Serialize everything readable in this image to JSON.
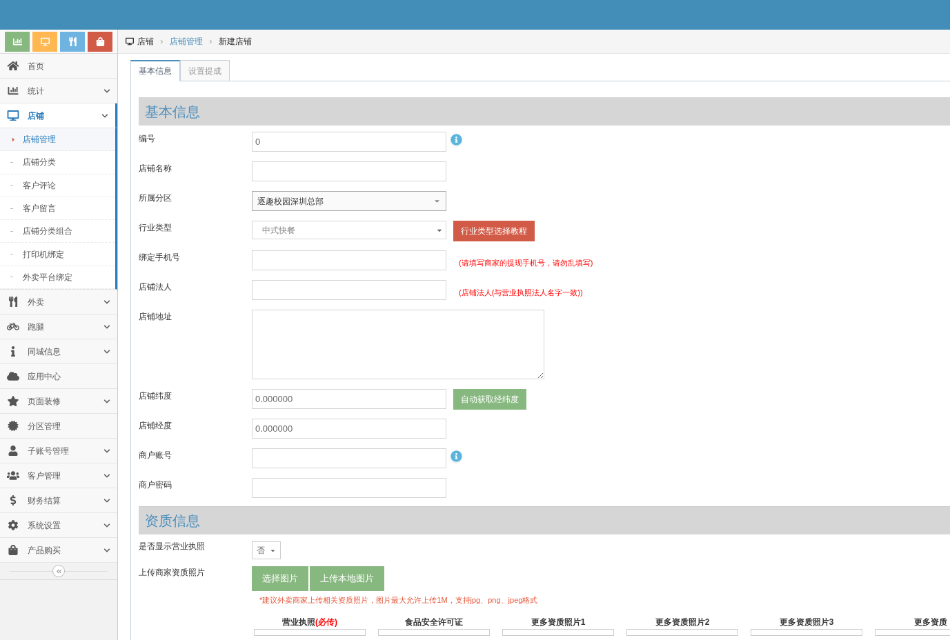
{
  "shortcuts": [
    {
      "color": "#87b87f"
    },
    {
      "color": "#ffb752"
    },
    {
      "color": "#6fb3e0"
    },
    {
      "color": "#d15b47"
    }
  ],
  "sidebar": {
    "items": [
      {
        "label": "首页",
        "kind": "link"
      },
      {
        "label": "统计",
        "kind": "menu",
        "expanded": false
      },
      {
        "label": "店铺",
        "kind": "menu",
        "expanded": true,
        "children": [
          {
            "label": "店铺管理",
            "selected": true
          },
          {
            "label": "店铺分类",
            "selected": false
          },
          {
            "label": "客户评论",
            "selected": false
          },
          {
            "label": "客户留言",
            "selected": false
          },
          {
            "label": "店铺分类组合",
            "selected": false
          },
          {
            "label": "打印机绑定",
            "selected": false
          },
          {
            "label": "外卖平台绑定",
            "selected": false
          }
        ]
      },
      {
        "label": "外卖",
        "kind": "menu",
        "expanded": false
      },
      {
        "label": "跑腿",
        "kind": "menu",
        "expanded": false
      },
      {
        "label": "同城信息",
        "kind": "menu",
        "expanded": false
      },
      {
        "label": "应用中心",
        "kind": "link"
      },
      {
        "label": "页面装修",
        "kind": "menu",
        "expanded": false
      },
      {
        "label": "分区管理",
        "kind": "link"
      },
      {
        "label": "子账号管理",
        "kind": "menu",
        "expanded": false
      },
      {
        "label": "客户管理",
        "kind": "menu",
        "expanded": false
      },
      {
        "label": "财务结算",
        "kind": "menu",
        "expanded": false
      },
      {
        "label": "系统设置",
        "kind": "menu",
        "expanded": false
      },
      {
        "label": "产品购买",
        "kind": "menu",
        "expanded": false
      }
    ]
  },
  "breadcrumb": [
    {
      "label": "店铺",
      "link": false
    },
    {
      "label": "店铺管理",
      "link": true
    },
    {
      "label": "新建店铺",
      "link": false
    }
  ],
  "tabs": [
    {
      "label": "基本信息",
      "selected": true
    },
    {
      "label": "设置提成",
      "selected": false
    }
  ],
  "basic_section": {
    "title": "基本信息",
    "rows": [
      {
        "label": "编号",
        "kind": "input",
        "value": "0",
        "info": true
      },
      {
        "label": "店铺名称",
        "kind": "input"
      },
      {
        "label": "所属分区",
        "kind": "select",
        "value": "逐趣校园深圳总部"
      },
      {
        "label": "行业类型",
        "kind": "plain-select",
        "value": "中式快餐",
        "button": {
          "label": "行业类型选择教程",
          "color": "#d15b47"
        }
      },
      {
        "label": "绑定手机号",
        "kind": "input",
        "hint": "(请填写商家的提现手机号，请勿乱填写)"
      },
      {
        "label": "店铺法人",
        "kind": "input",
        "hint": "(店铺法人(与营业执照法人名字一致))"
      },
      {
        "label": "店铺地址",
        "kind": "textarea"
      },
      {
        "label": "店铺纬度",
        "kind": "input",
        "value": "0.000000",
        "button": {
          "label": "自动获取经纬度",
          "color": "#87b87f"
        }
      },
      {
        "label": "店铺经度",
        "kind": "input",
        "value": "0.000000"
      },
      {
        "label": "商户账号",
        "kind": "input",
        "info": true
      },
      {
        "label": "商户密码",
        "kind": "input"
      }
    ]
  },
  "qualification_section": {
    "title": "资质信息",
    "show_license": {
      "label": "是否显示营业执照",
      "value": "否"
    },
    "upload": {
      "label": "上传商家资质照片",
      "buttons": [
        "选择图片",
        "上传本地图片"
      ],
      "note": "*建议外卖商家上传相关资质照片，图片最大允许上传1M，支持jpg、png、jpeg格式"
    },
    "photos": [
      {
        "label": "营业执照",
        "required": "(必传)"
      },
      {
        "label": "食品安全许可证"
      },
      {
        "label": "更多资质照片1"
      },
      {
        "label": "更多资质照片2"
      },
      {
        "label": "更多资质照片3"
      },
      {
        "label": "更多资质"
      }
    ]
  }
}
